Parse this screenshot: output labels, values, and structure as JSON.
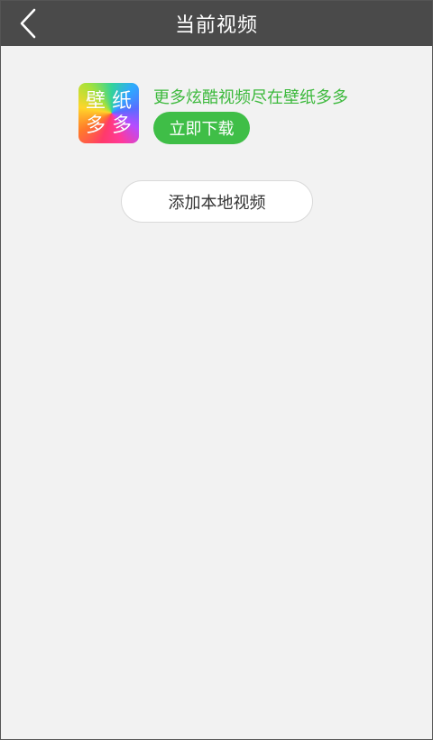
{
  "header": {
    "title": "当前视频",
    "back_icon": "chevron-left-icon"
  },
  "promo": {
    "app_icon_text": [
      "壁",
      "纸",
      "多",
      "多"
    ],
    "text": "更多炫酷视频尽在壁纸多多",
    "download_label": "立即下载"
  },
  "actions": {
    "add_local_label": "添加本地视频"
  },
  "colors": {
    "titlebar": "#4a4a4a",
    "background": "#f2f2f2",
    "accent_green": "#3fbe47",
    "promo_text": "#3cb93c"
  }
}
